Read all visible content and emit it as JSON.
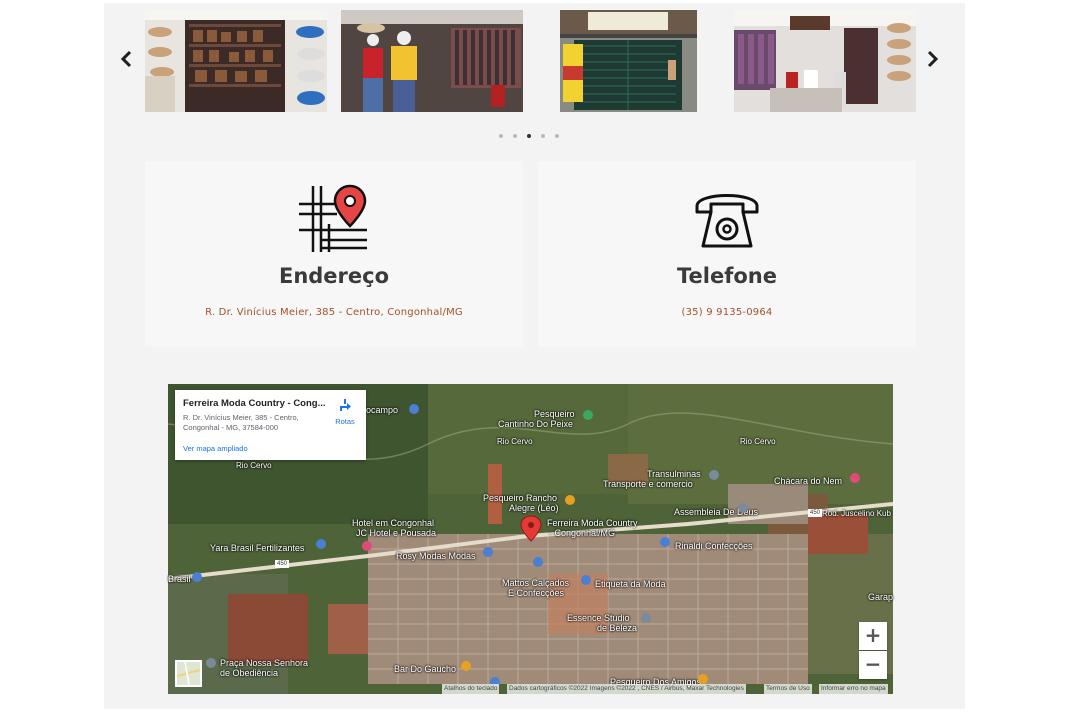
{
  "carousel": {
    "prev_icon": "chevron-left-icon",
    "next_icon": "chevron-right-icon",
    "slides": [
      {
        "name": "store-photo-hats-boots"
      },
      {
        "name": "store-photo-mannequins"
      },
      {
        "name": "store-photo-storefront"
      },
      {
        "name": "store-photo-interior"
      }
    ],
    "dots": 5,
    "active_dot": 3
  },
  "contact_cards": [
    {
      "icon": "map-pin-icon",
      "title": "Endereço",
      "value": "R. Dr. Vinícius Meier, 385 - Centro, Congonhal/MG"
    },
    {
      "icon": "phone-icon",
      "title": "Telefone",
      "value": "(35) 9 9135-0964"
    }
  ],
  "map": {
    "infobox": {
      "title": "Ferreira Moda Country - Cong...",
      "address_line1": "R. Dr. Vinícius Meier, 385 - Centro,",
      "address_line2": "Congonhal - MG, 37584-000",
      "link": "Ver mapa ampliado",
      "directions": "Rotas"
    },
    "labels": {
      "rocampo": "rocampo",
      "pesqueiro": "Pesqueiro",
      "cantinho": "Cantinho Do Peixe",
      "rio_cervo_a": "Rio Cervo",
      "rio_cervo_b": "Rio Cervo",
      "rio_cervo_c": "Rio Cervo",
      "transulminas_1": "Transulminas",
      "transulminas_2": "Transporte e comercio",
      "chacara": "Chácara do Nem",
      "rancho_1": "Pesqueiro Rancho",
      "rancho_2": "Alegre (Léo)",
      "assembleia": "Assembleia De Deus",
      "hotel_1": "Hotel em Congonhal",
      "hotel_2": "JC Hotel e Pousada",
      "ferreira_1": "Ferreira Moda Country",
      "ferreira_2": "- Congonhal/MG",
      "rod": "Rod. Juscelino Kub",
      "yara": "Yara Brasil Fertilizantes",
      "rosy": "Rosy Modas Modas",
      "rinaldi": "Rinaldi Confecções",
      "mattos_1": "Mattos Calçados",
      "mattos_2": "E Confecções",
      "etiqueta": "Etiqueta da Moda",
      "brasil": "Brasil",
      "essence_1": "Essence Studio",
      "essence_2": "de Beleza",
      "garap": "Garap",
      "praca_1": "Praça Nossa Senhora",
      "praca_2": "de Obediência",
      "bar": "Bar Do Gaucho",
      "pesq_amigos": "Pesqueiro Dos Amigos",
      "road_450a": "450",
      "road_450b": "450"
    },
    "zoom_in": "+",
    "zoom_out": "−",
    "attribution": {
      "keyboard": "Atalhos do teclado",
      "data": "Dados cartográficos ©2022 Imagens ©2022 , CNES / Airbus, Maxar Technologies",
      "terms": "Termos de Uso",
      "report": "Informar erro no mapa"
    }
  }
}
